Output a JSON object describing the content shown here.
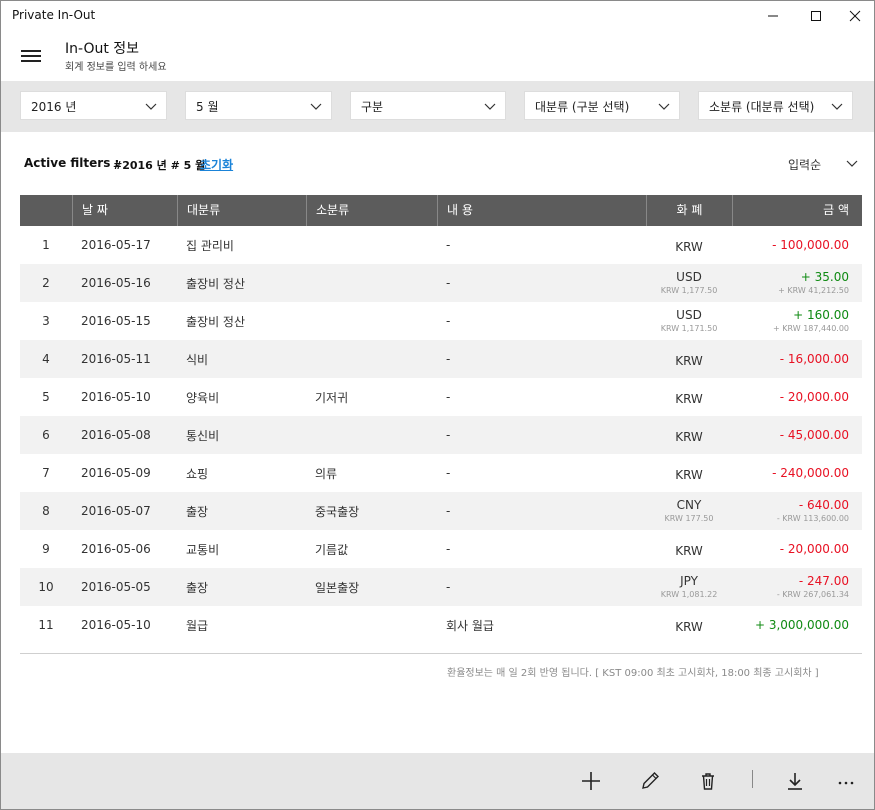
{
  "window": {
    "title": "Private In-Out"
  },
  "header": {
    "title": "In-Out 정보",
    "subtitle": "회계 정보를 입력 하세요"
  },
  "filters": {
    "year": "2016 년",
    "month": "5 월",
    "type": "구분",
    "category": "대분류 (구분 선택)",
    "subcategory": "소분류 (대분류 선택)"
  },
  "active_filters": {
    "label": "Active filters :",
    "value": "#2016 년 # 5 월",
    "reset": "초기화"
  },
  "sort": {
    "label": "입력순"
  },
  "table": {
    "columns": [
      "",
      "날 짜",
      "대분류",
      "소분류",
      "내 용",
      "화 폐",
      "금 액"
    ],
    "rows": [
      {
        "no": "1",
        "date": "2016-05-17",
        "category": "집 관리비",
        "sub": "",
        "desc": "-",
        "currency": "KRW",
        "rate": "",
        "amount": "- 100,000.00",
        "krw": "",
        "sign": "neg"
      },
      {
        "no": "2",
        "date": "2016-05-16",
        "category": "출장비 정산",
        "sub": "",
        "desc": "-",
        "currency": "USD",
        "rate": "KRW 1,177.50",
        "amount": "+ 35.00",
        "krw": "+ KRW 41,212.50",
        "sign": "pos"
      },
      {
        "no": "3",
        "date": "2016-05-15",
        "category": "출장비 정산",
        "sub": "",
        "desc": "-",
        "currency": "USD",
        "rate": "KRW 1,171.50",
        "amount": "+ 160.00",
        "krw": "+ KRW 187,440.00",
        "sign": "pos"
      },
      {
        "no": "4",
        "date": "2016-05-11",
        "category": "식비",
        "sub": "",
        "desc": "-",
        "currency": "KRW",
        "rate": "",
        "amount": "- 16,000.00",
        "krw": "",
        "sign": "neg"
      },
      {
        "no": "5",
        "date": "2016-05-10",
        "category": "양육비",
        "sub": "기저귀",
        "desc": "-",
        "currency": "KRW",
        "rate": "",
        "amount": "- 20,000.00",
        "krw": "",
        "sign": "neg"
      },
      {
        "no": "6",
        "date": "2016-05-08",
        "category": "통신비",
        "sub": "",
        "desc": "-",
        "currency": "KRW",
        "rate": "",
        "amount": "- 45,000.00",
        "krw": "",
        "sign": "neg"
      },
      {
        "no": "7",
        "date": "2016-05-09",
        "category": "쇼핑",
        "sub": "의류",
        "desc": "-",
        "currency": "KRW",
        "rate": "",
        "amount": "- 240,000.00",
        "krw": "",
        "sign": "neg"
      },
      {
        "no": "8",
        "date": "2016-05-07",
        "category": "출장",
        "sub": "중국출장",
        "desc": "-",
        "currency": "CNY",
        "rate": "KRW 177.50",
        "amount": "- 640.00",
        "krw": "- KRW 113,600.00",
        "sign": "neg"
      },
      {
        "no": "9",
        "date": "2016-05-06",
        "category": "교통비",
        "sub": "기름값",
        "desc": "-",
        "currency": "KRW",
        "rate": "",
        "amount": "- 20,000.00",
        "krw": "",
        "sign": "neg"
      },
      {
        "no": "10",
        "date": "2016-05-05",
        "category": "출장",
        "sub": "일본출장",
        "desc": "-",
        "currency": "JPY",
        "rate": "KRW 1,081.22",
        "amount": "- 247.00",
        "krw": "- KRW 267,061.34",
        "sign": "neg"
      },
      {
        "no": "11",
        "date": "2016-05-10",
        "category": "월급",
        "sub": "",
        "desc": "회사 월급",
        "currency": "KRW",
        "rate": "",
        "amount": "+ 3,000,000.00",
        "krw": "",
        "sign": "pos"
      }
    ]
  },
  "footnote": "환율정보는 매 일 2회 반영 됩니다. [ KST 09:00 최초 고시회차, 18:00 최종 고시회차 ]",
  "commands": [
    {
      "name": "add-icon"
    },
    {
      "name": "edit-icon"
    },
    {
      "name": "delete-icon"
    },
    {
      "name": "download-icon"
    },
    {
      "name": "more-icon"
    }
  ],
  "colors": {
    "negative": "#e81123",
    "positive": "#0f8a12",
    "link": "#1a83d8",
    "header_bg": "#5c5c5c",
    "bar_bg": "#e6e6e6"
  }
}
